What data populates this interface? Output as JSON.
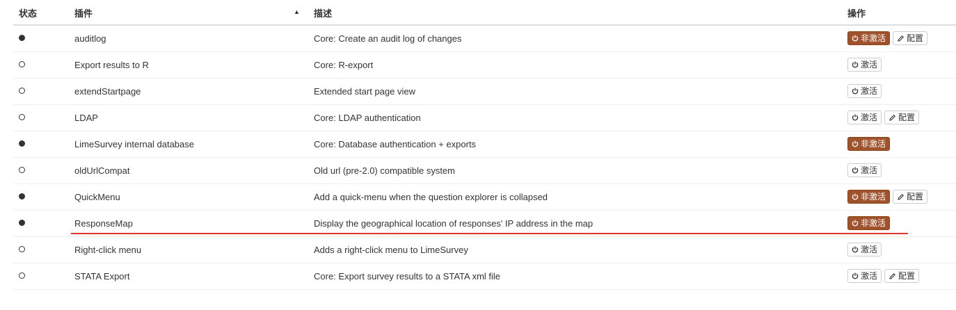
{
  "table": {
    "headers": {
      "status": "状态",
      "plugin": "插件",
      "sort_indicator": "▲",
      "description": "描述",
      "actions": "操作"
    },
    "rows": [
      {
        "active": true,
        "name": "auditlog",
        "description": "Core: Create an audit log of changes",
        "toggle_label": "非激活",
        "has_config": true,
        "config_label": "配置"
      },
      {
        "active": false,
        "name": "Export results to R",
        "description": "Core: R-export",
        "toggle_label": "激活",
        "has_config": false,
        "config_label": ""
      },
      {
        "active": false,
        "name": "extendStartpage",
        "description": "Extended start page view",
        "toggle_label": "激活",
        "has_config": false,
        "config_label": ""
      },
      {
        "active": false,
        "name": "LDAP",
        "description": "Core: LDAP authentication",
        "toggle_label": "激活",
        "has_config": true,
        "config_label": "配置"
      },
      {
        "active": true,
        "name": "LimeSurvey internal database",
        "description": "Core: Database authentication + exports",
        "toggle_label": "非激活",
        "has_config": false,
        "config_label": ""
      },
      {
        "active": false,
        "name": "oldUrlCompat",
        "description": "Old url (pre-2.0) compatible system",
        "toggle_label": "激活",
        "has_config": false,
        "config_label": ""
      },
      {
        "active": true,
        "name": "QuickMenu",
        "description": "Add a quick-menu when the question explorer is collapsed",
        "toggle_label": "非激活",
        "has_config": true,
        "config_label": "配置"
      },
      {
        "active": true,
        "name": "ResponseMap",
        "description": "Display the geographical location of responses' IP address in the map",
        "toggle_label": "非激活",
        "has_config": false,
        "config_label": ""
      },
      {
        "active": false,
        "name": "Right-click menu",
        "description": "Adds a right-click menu to LimeSurvey",
        "toggle_label": "激活",
        "has_config": false,
        "config_label": ""
      },
      {
        "active": false,
        "name": "STATA Export",
        "description": "Core: Export survey results to a STATA xml file",
        "toggle_label": "激活",
        "has_config": true,
        "config_label": "配置"
      }
    ]
  },
  "icons": {
    "toggle": "power-icon",
    "config": "pencil-icon",
    "status": "circle-icon"
  },
  "colors": {
    "deactivate_bg": "#a0522d",
    "highlight_underline": "#e0352b",
    "status_dot": "#333333"
  },
  "annotation": {
    "underlined_row": "ResponseMap"
  }
}
